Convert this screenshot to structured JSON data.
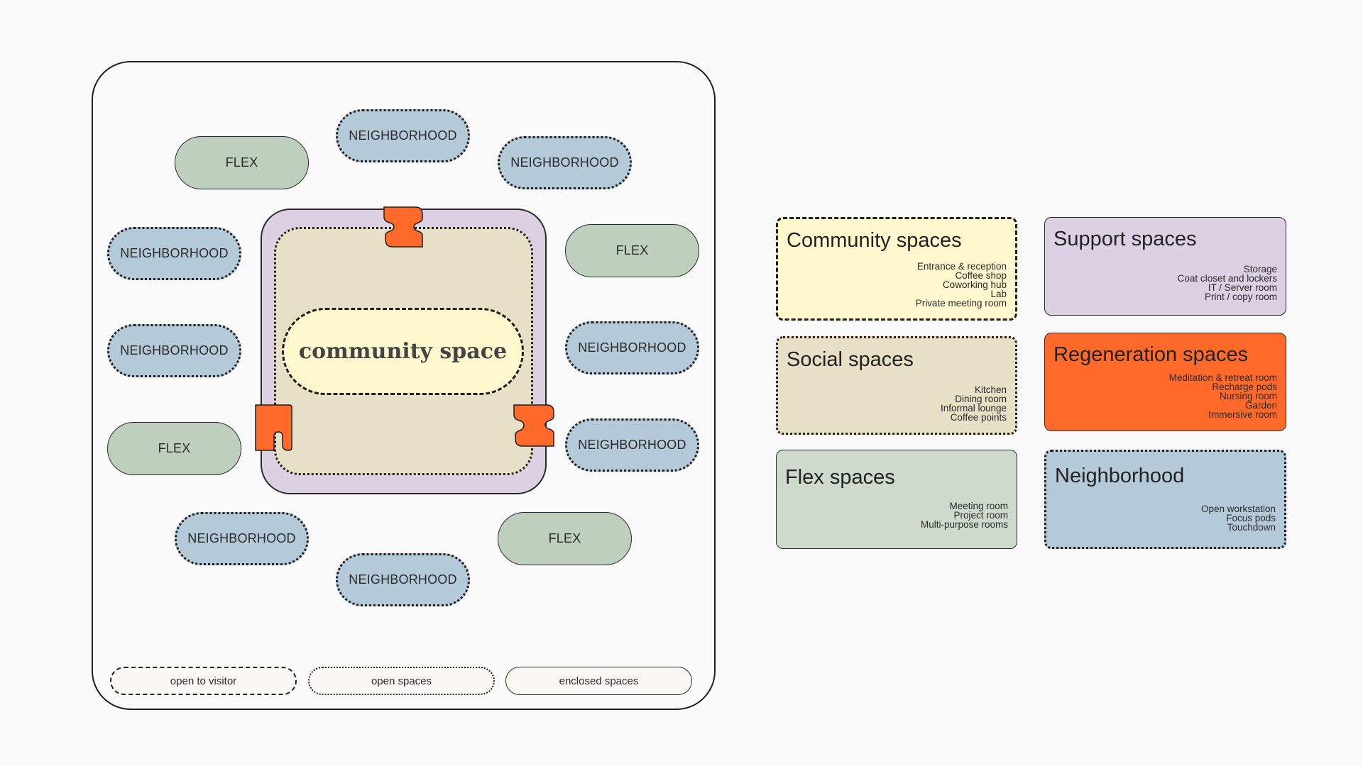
{
  "diagram": {
    "flex_label": "FLEX",
    "neighborhood_label": "NEIGHBORHOOD",
    "center_label": "community space",
    "legend": {
      "open_to_visitor": "open to visitor",
      "open_spaces": "open spaces",
      "enclosed_spaces": "enclosed spaces"
    }
  },
  "cards": {
    "community": {
      "title": "Community spaces",
      "color": "#fff8cf",
      "items": [
        "Entrance & reception",
        "Coffee shop",
        "Coworking hub",
        "Lab",
        "Private meeting room"
      ]
    },
    "support": {
      "title": "Support spaces",
      "color": "#dcd0e3",
      "items": [
        "Storage",
        "Coat closet and lockers",
        "IT / Server room",
        "Print / copy room"
      ]
    },
    "social": {
      "title": "Social spaces",
      "color": "#e8e0c6",
      "items": [
        "Kitchen",
        "Dining room",
        "Informal lounge",
        "Coffee points"
      ]
    },
    "regeneration": {
      "title": "Regeneration spaces",
      "color": "#ff6a2b",
      "items": [
        "Meditation & retreat room",
        "Recharge pods",
        "Nursing room",
        "Garden",
        "Immersive room"
      ]
    },
    "flex": {
      "title": "Flex spaces",
      "color": "#cfdacc",
      "items": [
        "Meeting room",
        "Project room",
        "Multi-purpose rooms"
      ]
    },
    "neighborhood": {
      "title": "Neighborhood",
      "color": "#b5cad8",
      "items": [
        "Open workstation",
        "Focus pods",
        "Touchdown"
      ]
    }
  }
}
